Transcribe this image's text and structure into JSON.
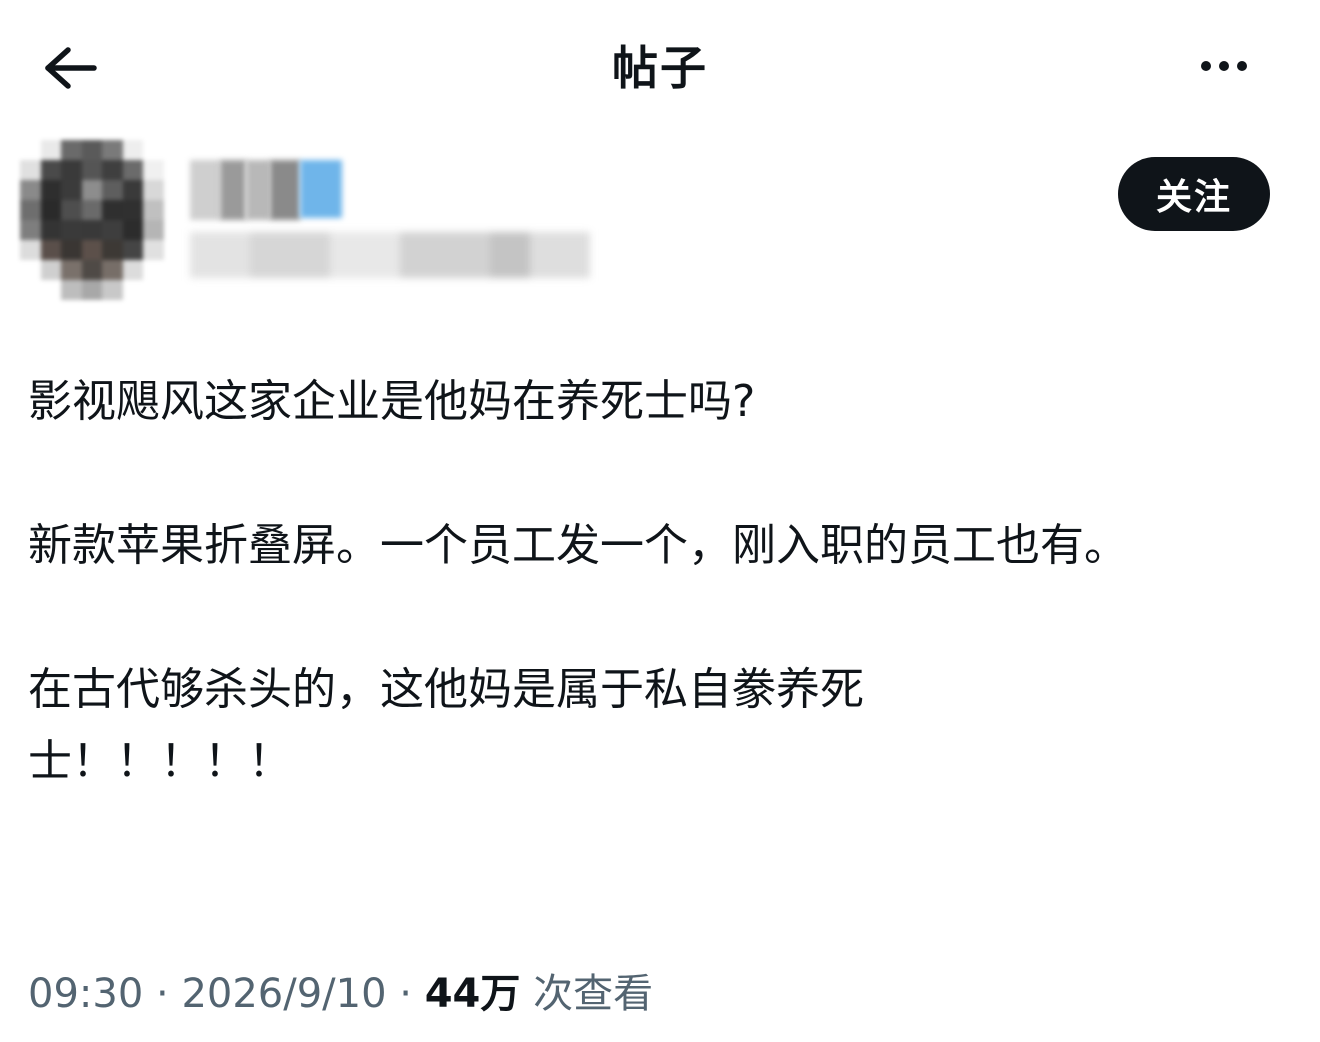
{
  "header": {
    "title": "帖子"
  },
  "author": {
    "follow_label": "关注"
  },
  "post": {
    "paragraphs": [
      "影视飓风这家企业是他妈在养死士吗?",
      "新款苹果折叠屏。一个员工发一个，刚入职的员工也有。",
      "在古代够杀头的，这他妈是属于私自豢养死士！！！！！"
    ]
  },
  "meta": {
    "time": "09:30",
    "separator": "·",
    "date": "2026/9/10",
    "views_count": "44万",
    "views_label": "次查看"
  },
  "colors": {
    "text_primary": "#0f1419",
    "text_secondary": "#536471",
    "follow_button_bg": "#0f1419",
    "verified_badge": "#6fb5ea"
  },
  "icons": {
    "back": "arrow-left-icon",
    "more": "more-horizontal-icon"
  }
}
